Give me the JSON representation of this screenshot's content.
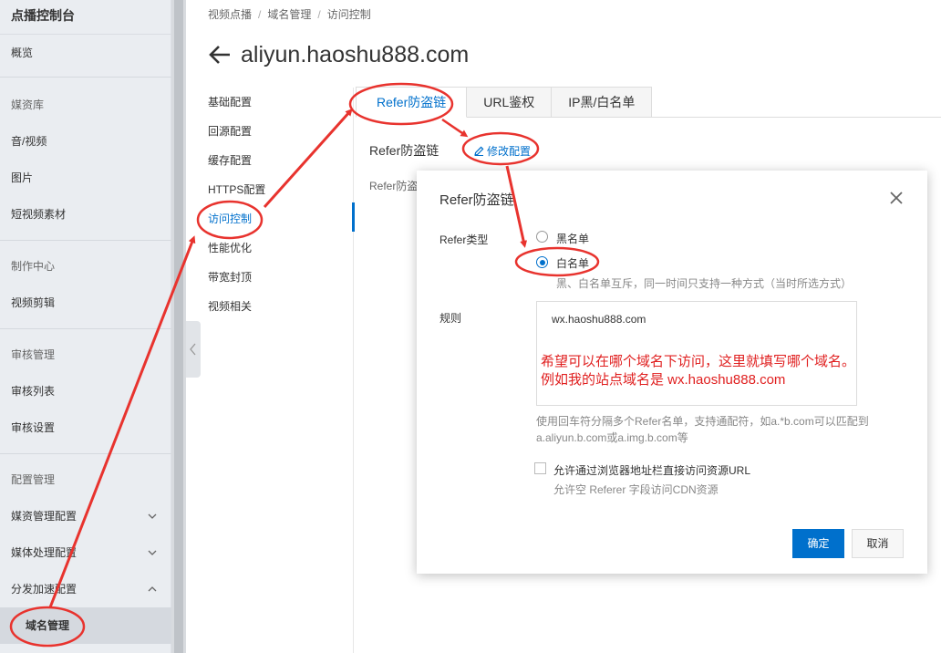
{
  "sidebar": {
    "title": "点播控制台",
    "overview": "概览",
    "media_group": "媒资库",
    "audio_video": "音/视频",
    "images": "图片",
    "short_video": "短视频素材",
    "production_group": "制作中心",
    "video_edit": "视频剪辑",
    "review_group": "审核管理",
    "review_list": "审核列表",
    "review_settings": "审核设置",
    "config_group": "配置管理",
    "media_mgmt_config": "媒资管理配置",
    "media_proc_config": "媒体处理配置",
    "dist_accel_config": "分发加速配置",
    "domain_mgmt": "域名管理"
  },
  "breadcrumb": {
    "items": [
      "视频点播",
      "域名管理",
      "访问控制"
    ],
    "sep": "/"
  },
  "page": {
    "title": "aliyun.haoshu888.com"
  },
  "subnav": {
    "items": [
      "基础配置",
      "回源配置",
      "缓存配置",
      "HTTPS配置",
      "访问控制",
      "性能优化",
      "带宽封顶",
      "视频相关"
    ]
  },
  "tabs": [
    "Refer防盗链",
    "URL鉴权",
    "IP黑/白名单"
  ],
  "section": {
    "title": "Refer防盗链",
    "edit_label": "修改配置",
    "bg_row_label": "Refer防盗"
  },
  "dialog": {
    "title": "Refer防盗链",
    "refer_type_label": "Refer类型",
    "option_blacklist": "黑名单",
    "option_whitelist": "白名单",
    "type_hint": "黑、白名单互斥，同一时间只支持一种方式（当时所选方式）",
    "rules_label": "规则",
    "rules_value": "wx.haoshu888.com",
    "annotation_line1": "希望可以在哪个域名下访问，这里就填写哪个域名。",
    "annotation_line2": "例如我的站点域名是 wx.haoshu888.com",
    "rules_hint_line1": "使用回车符分隔多个Refer名单，支持通配符，如a.*b.com可以匹配到",
    "rules_hint_line2": "a.aliyun.b.com或a.img.b.com等",
    "allow_empty_label": "允许通过浏览器地址栏直接访问资源URL",
    "allow_empty_hint": "允许空 Referer 字段访问CDN资源",
    "confirm_label": "确定",
    "cancel_label": "取消"
  },
  "colors": {
    "accent": "#0070cc",
    "annotation": "#e8332e"
  }
}
